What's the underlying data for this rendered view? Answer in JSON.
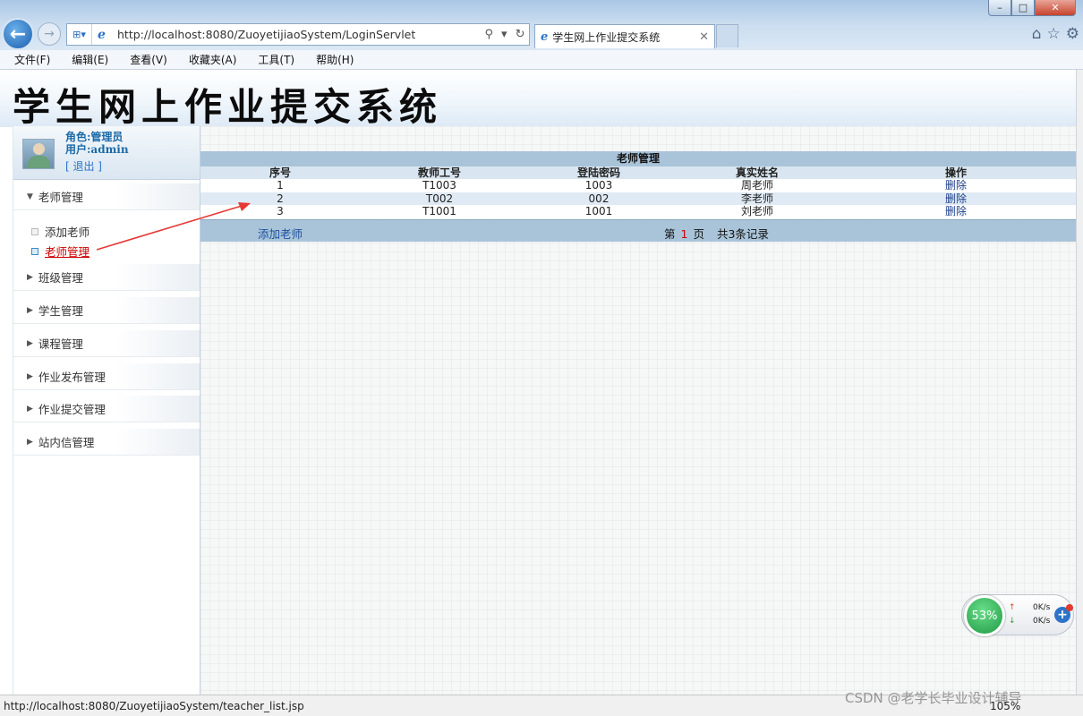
{
  "browser": {
    "address_url": "http://localhost:8080/ZuoyetijiaoSystem/LoginServlet",
    "tab_title": "学生网上作业提交系统",
    "menu": [
      "文件(F)",
      "编辑(E)",
      "查看(V)",
      "收藏夹(A)",
      "工具(T)",
      "帮助(H)"
    ],
    "status_url": "http://localhost:8080/ZuoyetijiaoSystem/teacher_list.jsp",
    "zoom": "105%"
  },
  "page": {
    "banner_title": "学生网上作业提交系统",
    "user": {
      "role": "角色:管理员",
      "name": "用户:admin",
      "logout": "[ 退出 ]"
    },
    "sidebar": {
      "sections": [
        {
          "label": "老师管理"
        },
        {
          "label": "班级管理"
        },
        {
          "label": "学生管理"
        },
        {
          "label": "课程管理"
        },
        {
          "label": "作业发布管理"
        },
        {
          "label": "作业提交管理"
        },
        {
          "label": "站内信管理"
        }
      ],
      "sub_items": [
        {
          "label": "添加老师"
        },
        {
          "label": "老师管理"
        }
      ]
    },
    "panel": {
      "title": "老师管理",
      "columns": [
        "序号",
        "教师工号",
        "登陆密码",
        "真实姓名",
        "操作"
      ],
      "rows": [
        {
          "no": "1",
          "id": "T1003",
          "password": "1003",
          "name": "周老师",
          "action": "删除"
        },
        {
          "no": "2",
          "id": "T002",
          "password": "002",
          "name": "李老师",
          "action": "删除"
        },
        {
          "no": "3",
          "id": "T1001",
          "password": "1001",
          "name": "刘老师",
          "action": "删除"
        }
      ],
      "add_link": "添加老师",
      "pager": {
        "prefix": "第",
        "current": "1",
        "unit": "页",
        "total": "共3条记录"
      }
    }
  },
  "network_widget": {
    "percent": "53%",
    "up": "0K/s",
    "down": "0K/s"
  },
  "watermark": "CSDN @老学长毕业设计辅导"
}
